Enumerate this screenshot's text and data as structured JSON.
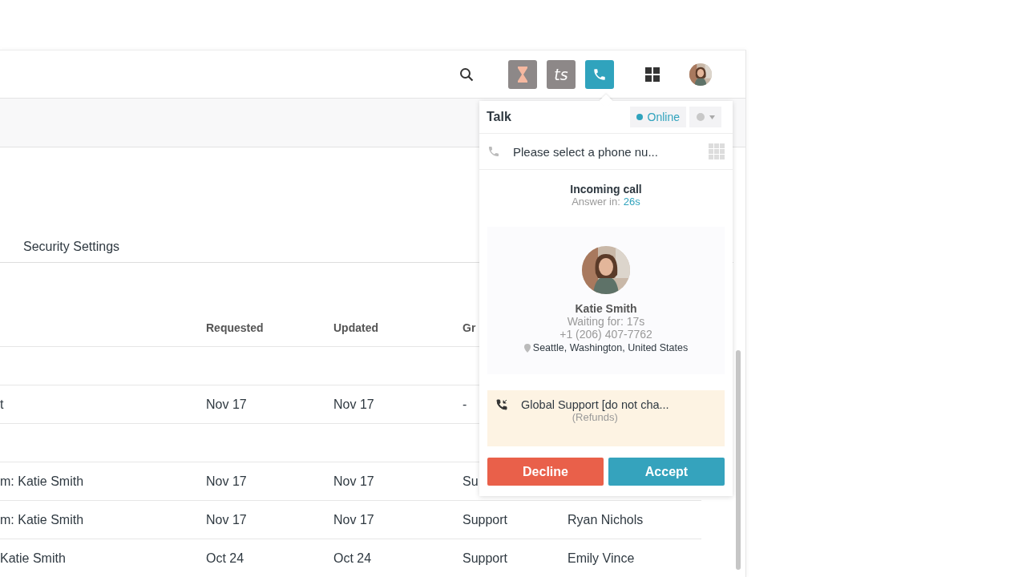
{
  "toolbar": [
    {
      "kind": "search",
      "selected": false
    },
    {
      "kind": "hourglass",
      "selected": false
    },
    {
      "kind": "ts",
      "label": "ts",
      "selected": false
    },
    {
      "kind": "phone",
      "selected": true
    },
    {
      "kind": "apps",
      "selected": false
    },
    {
      "kind": "avatar",
      "selected": false
    }
  ],
  "tabs": [
    {
      "label": "Security Settings"
    }
  ],
  "table": {
    "columns": [
      "Requested",
      "Updated",
      "Gr"
    ],
    "rows": [
      {
        "kind": "blank"
      },
      {
        "kind": "ticket",
        "cells": [
          "t",
          "Nov 17",
          "Nov 17",
          "-"
        ]
      },
      {
        "kind": "blank"
      },
      {
        "kind": "ticket",
        "cells": [
          "m: Katie Smith",
          "Nov 17",
          "Nov 17",
          "Su"
        ]
      },
      {
        "kind": "ticket",
        "cells": [
          "m: Katie Smith",
          "Nov 17",
          "Nov 17",
          "Support",
          "Ryan Nichols"
        ]
      },
      {
        "kind": "ticket",
        "cells": [
          "Katie Smith",
          "Oct 24",
          "Oct 24",
          "Support",
          "Emily Vince"
        ]
      }
    ]
  },
  "talk": {
    "title": "Talk",
    "status": "Online",
    "phone_placeholder": "Please select a phone nu...",
    "heading": "Incoming call",
    "answer_label": "Answer in:",
    "answer_time": "26s",
    "caller": {
      "name": "Katie Smith",
      "waiting": "Waiting for: 17s",
      "phone": "+1 (206) 407-7762",
      "location": "Seattle, Washington, United States"
    },
    "line": {
      "name": "Global Support [do not cha...",
      "group": "(Refunds)"
    },
    "buttons": [
      {
        "kind": "decline",
        "label": "Decline"
      },
      {
        "kind": "accept",
        "label": "Accept"
      }
    ]
  }
}
